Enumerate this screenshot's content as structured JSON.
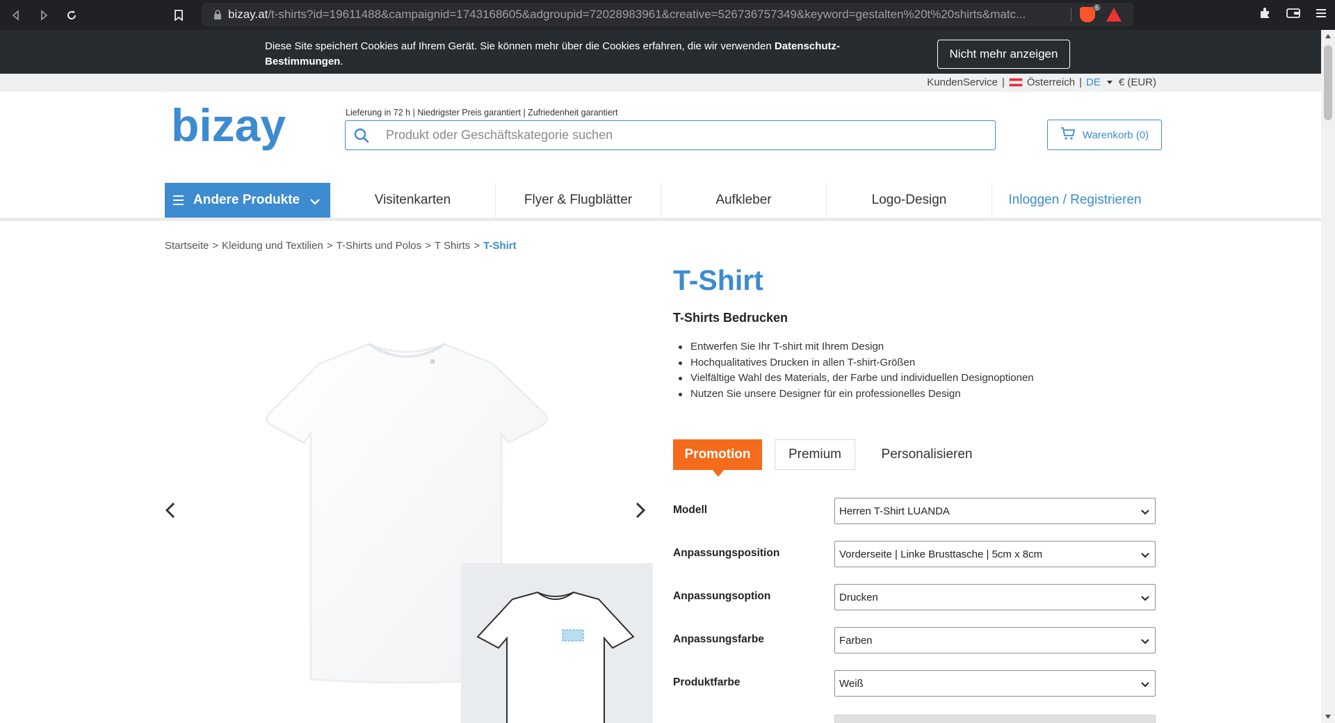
{
  "browser": {
    "url_host": "bizay.at",
    "url_path": "/t-shirts?id=19611488&campaignid=1743168605&adgroupid=72028983961&creative=526736757349&keyword=gestalten%20t%20shirts&matc...",
    "shield_count": "6"
  },
  "cookie": {
    "text_before": "Diese Site speichert Cookies auf Ihrem Gerät. Sie können mehr über die Cookies erfahren, die wir verwenden ",
    "link_text": "Datenschutz-Bestimmungen",
    "text_after": ".",
    "button_label": "Nicht mehr anzeigen"
  },
  "utility": {
    "customer_service": "KundenService",
    "separator": "|",
    "country": "Österreich",
    "language": "DE",
    "currency": "€ (EUR)"
  },
  "header": {
    "logo_text": "bizay",
    "tagline": "Lieferung in 72 h  |  Niedrigster Preis garantiert  |  Zufriedenheit garantiert",
    "search_placeholder": "Produkt oder Geschäftskategorie suchen",
    "cart_label": "Warenkorb (0)"
  },
  "nav": {
    "other_products": "Andere Produkte",
    "items": [
      "Visitenkarten",
      "Flyer & Flugblätter",
      "Aufkleber",
      "Logo-Design"
    ],
    "login": "Inloggen / Registrieren"
  },
  "breadcrumb": {
    "items": [
      "Startseite",
      "Kleidung und Textilien",
      "T-Shirts und Polos",
      "T Shirts"
    ],
    "separator": ">",
    "current": "T-Shirt"
  },
  "product": {
    "title": "T-Shirt",
    "subtitle": "T-Shirts Bedrucken",
    "bullets": [
      "Entwerfen Sie Ihr T-shirt mit Ihrem Design",
      "Hochqualitatives Drucken in allen T-shirt-Größen",
      "Vielfältige Wahl des Materials, der Farbe und individuellen Designoptionen",
      "Nutzen Sie unsere Designer für ein professionelles Design"
    ],
    "tabs": [
      "Promotion",
      "Premium",
      "Personalisieren"
    ],
    "options": [
      {
        "label": "Modell",
        "value": "Herren T-Shirt LUANDA"
      },
      {
        "label": "Anpassungsposition",
        "value": "Vorderseite | Linke Brusttasche | 5cm x 8cm"
      },
      {
        "label": "Anpassungsoption",
        "value": "Drucken"
      },
      {
        "label": "Anpassungsfarbe",
        "value": "Farben"
      },
      {
        "label": "Produktfarbe",
        "value": "Weiß"
      }
    ]
  },
  "colors": {
    "brand_blue": "#3d8bd0",
    "promo_orange": "#f46b1c",
    "cookie_bg": "#272c30"
  }
}
